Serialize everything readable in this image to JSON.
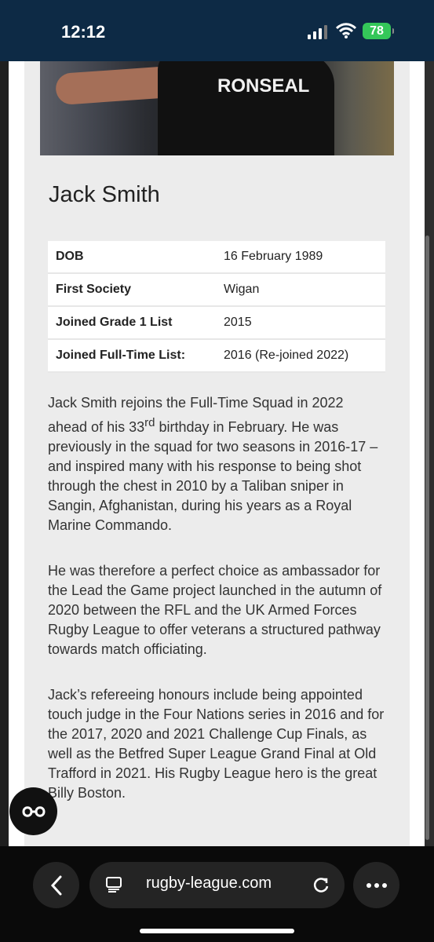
{
  "status_bar": {
    "time": "12:12",
    "battery": "78"
  },
  "hero": {
    "sponsor": "RONSEAL"
  },
  "profile": {
    "name": "Jack Smith",
    "details": [
      {
        "label": "DOB",
        "value": "16 February 1989"
      },
      {
        "label": "First Society",
        "value": "Wigan"
      },
      {
        "label": "Joined Grade 1 List",
        "value": "2015"
      },
      {
        "label": "Joined Full-Time List:",
        "value": "2016 (Re-joined 2022)"
      }
    ],
    "bio": {
      "p1_a": "Jack Smith rejoins the Full-Time Squad in 2022 ahead of his 33",
      "p1_sup": "rd",
      "p1_b": " birthday in February. He was previously in the squad for two seasons in 2016-17 – and inspired many with his response to being shot through the chest in 2010 by a Taliban sniper in Sangin, Afghanistan, during his years as a Royal Marine Commando.",
      "p2": "He was therefore a perfect choice as ambassador for the Lead the Game project launched in the autumn of 2020 between the RFL and the UK Armed Forces Rugby League to offer veterans a structured pathway towards match officiating.",
      "p3": "Jack’s refereeing honours include being appointed touch judge in the Four Nations series in 2016 and for the 2017, 2020 and 2021 Challenge Cup Finals, as well as the Betfred Super League Grand Final at Old Trafford in 2021. His Rugby League hero is the great Billy Boston."
    }
  },
  "browser": {
    "url": "rugby-league.com",
    "icons": [
      "back-icon",
      "page-icon",
      "reload-icon",
      "more-icon"
    ]
  },
  "colors": {
    "status_bar": "#0d2a45",
    "battery": "#34c759",
    "card": "#ececec",
    "toolbar": "#0a0a0a"
  }
}
